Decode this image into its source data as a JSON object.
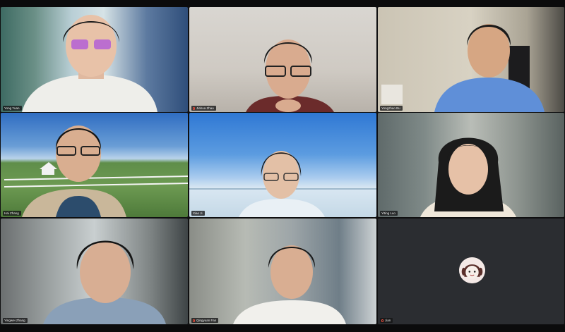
{
  "meeting": {
    "participants": [
      {
        "id": "p1",
        "name": "Yong Yuan",
        "video_on": true,
        "mic_muted": false
      },
      {
        "id": "p2",
        "name": "Jiahua Zhao",
        "video_on": true,
        "mic_muted": true
      },
      {
        "id": "p3",
        "name": "Yongzhao Bu",
        "video_on": true,
        "mic_muted": false
      },
      {
        "id": "p4",
        "name": "Hai Zhang",
        "video_on": true,
        "mic_muted": false
      },
      {
        "id": "p5",
        "name": "Xiao Ji",
        "video_on": true,
        "mic_muted": false
      },
      {
        "id": "p6",
        "name": "Yiting Luo",
        "video_on": true,
        "mic_muted": false
      },
      {
        "id": "p7",
        "name": "Yingwei Zhang",
        "video_on": true,
        "mic_muted": false
      },
      {
        "id": "p8",
        "name": "Qingyuan Fan",
        "video_on": true,
        "mic_muted": true
      },
      {
        "id": "p9",
        "name": "Jian",
        "video_on": false,
        "mic_muted": true
      }
    ]
  },
  "colors": {
    "gallery_background": "#0f0f10",
    "muted_mic": "#e74c3c",
    "name_tag_background": "#141416"
  },
  "icons": {
    "muted": "mic-muted-icon",
    "avatar": "cartoon-avatar-icon"
  }
}
